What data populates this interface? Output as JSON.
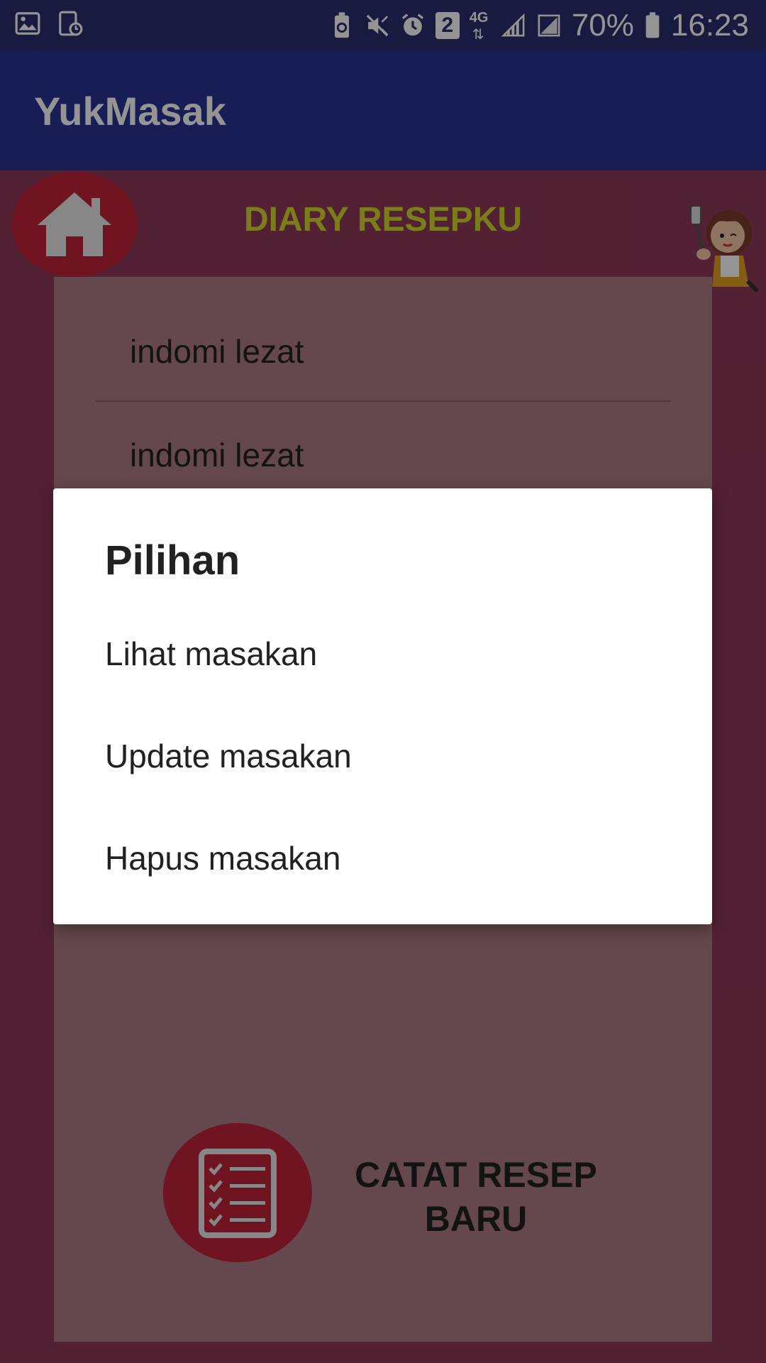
{
  "status_bar": {
    "battery_percent": "70%",
    "time": "16:23",
    "notification_count": "2",
    "network_type": "4G",
    "left_icons": [
      "gallery-icon",
      "screenshot-icon"
    ],
    "right_icons": [
      "battery-saver-icon",
      "mute-icon",
      "alarm-icon",
      "sim-badge-icon",
      "data-arrows-icon",
      "signal-icon",
      "signal-icon",
      "battery-icon"
    ]
  },
  "app_bar": {
    "title": "YukMasak"
  },
  "header": {
    "home_icon": "home-icon",
    "title": "DIARY RESEPKU",
    "mascot_icon": "chef-mascot-icon"
  },
  "list": {
    "items": [
      {
        "label": "indomi lezat"
      },
      {
        "label": "indomi lezat"
      }
    ]
  },
  "action": {
    "icon": "checklist-icon",
    "label_line1": "CATAT RESEP",
    "label_line2": "BARU"
  },
  "dialog": {
    "title": "Pilihan",
    "options": [
      {
        "label": "Lihat masakan"
      },
      {
        "label": "Update masakan"
      },
      {
        "label": "Hapus masakan"
      }
    ]
  },
  "colors": {
    "status_bar": "#2a2d6e",
    "app_bar": "#283593",
    "background": "#8e3a58",
    "panel": "#ad7c86",
    "accent_red": "#c2243a",
    "title_yellow": "#d6d630"
  }
}
